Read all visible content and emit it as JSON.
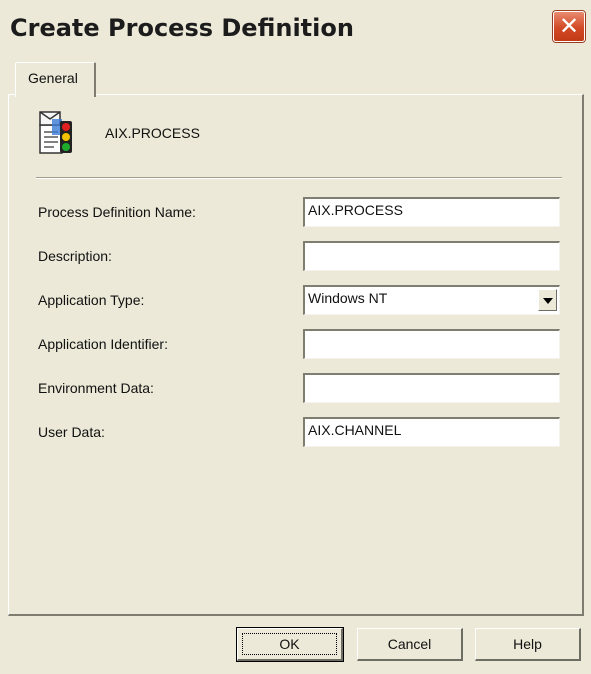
{
  "window": {
    "title": "Create Process Definition",
    "close_glyph": "✕"
  },
  "tabs": [
    {
      "label": "General",
      "active": true
    }
  ],
  "object": {
    "name": "AIX.PROCESS",
    "icon": "process-definition-icon"
  },
  "fields": {
    "process_definition_name": {
      "label": "Process Definition Name:",
      "value": "AIX.PROCESS"
    },
    "description": {
      "label": "Description:",
      "value": ""
    },
    "application_type": {
      "label": "Application Type:",
      "value": "Windows NT"
    },
    "application_identifier": {
      "label": "Application Identifier:",
      "value": ""
    },
    "environment_data": {
      "label": "Environment Data:",
      "value": ""
    },
    "user_data": {
      "label": "User Data:",
      "value": "AIX.CHANNEL"
    }
  },
  "buttons": {
    "ok": "OK",
    "cancel": "Cancel",
    "help": "Help"
  },
  "colors": {
    "face": "#ece9d8",
    "close_red": "#d24a25"
  }
}
